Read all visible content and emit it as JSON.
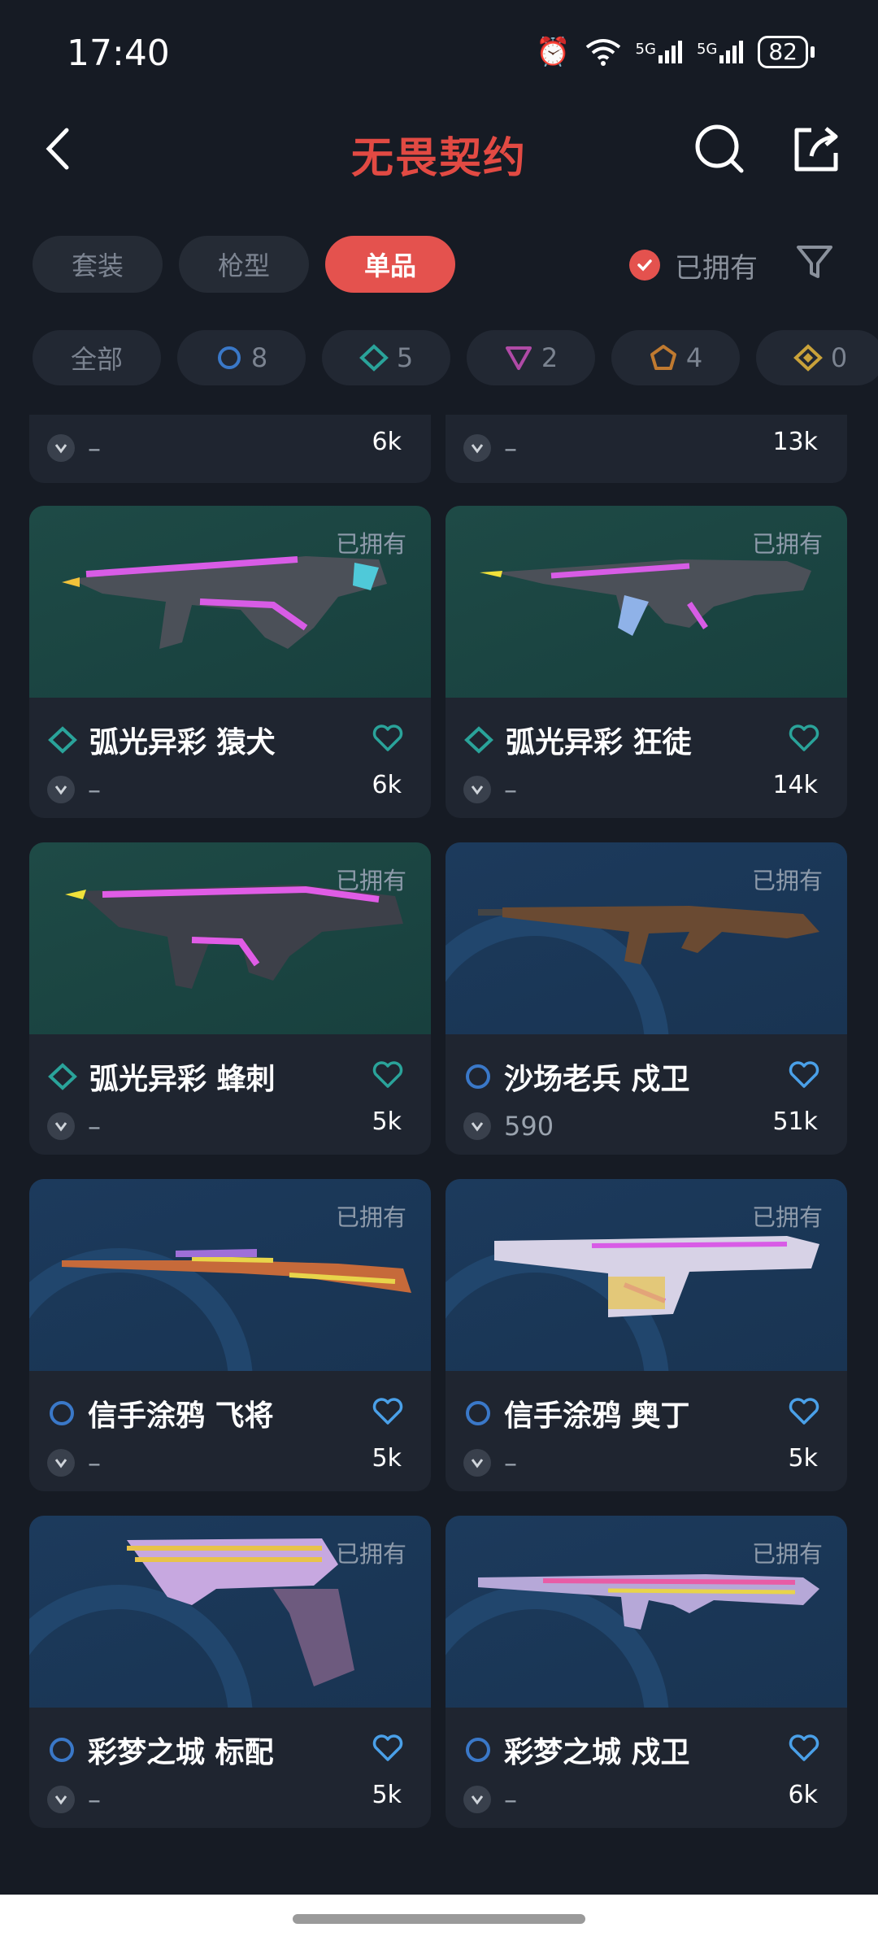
{
  "status": {
    "time": "17:40",
    "battery": "82",
    "net1": "5G",
    "net2": "5G"
  },
  "header": {
    "logo": "无畏契约",
    "back_icon": "chevron-left-icon",
    "search_icon": "search-icon",
    "share_icon": "share-icon"
  },
  "tabs": [
    {
      "label": "套装",
      "active": false
    },
    {
      "label": "枪型",
      "active": false
    },
    {
      "label": "单品",
      "active": true
    }
  ],
  "owned_filter": {
    "label": "已拥有",
    "checked": true
  },
  "rarity_chips": [
    {
      "label": "全部"
    },
    {
      "count": "8",
      "color": "#3a78c8"
    },
    {
      "count": "5",
      "color": "#2aa39a"
    },
    {
      "count": "2",
      "color": "#b04aa6"
    },
    {
      "count": "4",
      "color": "#c07a30"
    },
    {
      "count": "0",
      "color": "#c9a23a"
    }
  ],
  "partial_cards": [
    {
      "price": "–",
      "likes": "6k"
    },
    {
      "price": "–",
      "likes": "13k"
    }
  ],
  "cards": [
    {
      "owned": "已拥有",
      "title": "弧光异彩 猿犬",
      "price": "–",
      "likes": "6k",
      "tier_color": "#2aa39a",
      "bg": "green"
    },
    {
      "owned": "已拥有",
      "title": "弧光异彩 狂徒",
      "price": "–",
      "likes": "14k",
      "tier_color": "#2aa39a",
      "bg": "green"
    },
    {
      "owned": "已拥有",
      "title": "弧光异彩 蜂刺",
      "price": "–",
      "likes": "5k",
      "tier_color": "#2aa39a",
      "bg": "green"
    },
    {
      "owned": "已拥有",
      "title": "沙场老兵 戍卫",
      "price": "590",
      "likes": "51k",
      "tier_color": "#3a78c8",
      "bg": "blue"
    },
    {
      "owned": "已拥有",
      "title": "信手涂鸦 飞将",
      "price": "–",
      "likes": "5k",
      "tier_color": "#3a78c8",
      "bg": "blue"
    },
    {
      "owned": "已拥有",
      "title": "信手涂鸦 奥丁",
      "price": "–",
      "likes": "5k",
      "tier_color": "#3a78c8",
      "bg": "blue"
    },
    {
      "owned": "已拥有",
      "title": "彩梦之城 标配",
      "price": "–",
      "likes": "5k",
      "tier_color": "#3a78c8",
      "bg": "blue"
    },
    {
      "owned": "已拥有",
      "title": "彩梦之城 戍卫",
      "price": "–",
      "likes": "6k",
      "tier_color": "#3a78c8",
      "bg": "blue"
    }
  ]
}
